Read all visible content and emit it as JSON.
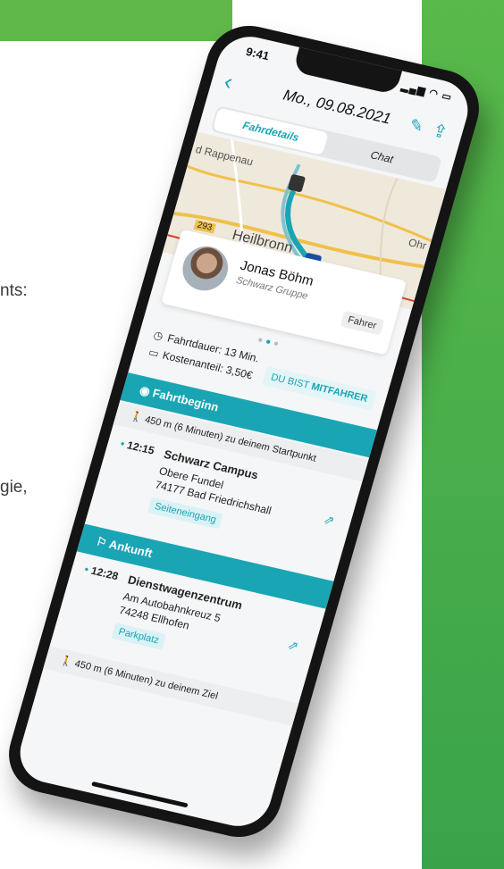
{
  "background": {
    "text_fragment_1": "nts:",
    "text_fragment_2": "gie,"
  },
  "status": {
    "time": "9:41",
    "icons": "▂▄▆ ◠ ▭"
  },
  "header": {
    "back": "‹",
    "title": "Mo., 09.08.2021",
    "edit": "✎",
    "share": "⇪"
  },
  "tabs": {
    "left": "Fahrdetails",
    "right": "Chat"
  },
  "map": {
    "label_top": "d Rappenau",
    "label_road": "293",
    "label_city": "Heilbronn",
    "label_right": "Ohr"
  },
  "driver": {
    "name": "Jonas Böhm",
    "group": "Schwarz Gruppe",
    "role": "Fahrer"
  },
  "pager": {
    "dot1": "●",
    "dot2": "●",
    "dot3": "●"
  },
  "meta": {
    "duration": "Fahrtdauer: 13 Min.",
    "cost": "Kostenanteil: 3,50€",
    "clock_icon": "◷",
    "card_icon": "▭"
  },
  "badge": {
    "prefix": "DU BIST ",
    "strong": "MITFAHRER"
  },
  "start": {
    "header": "Fahrtbeginn",
    "header_icon": "◉",
    "walk": "450 m (6 Minuten) zu deinem Startpunkt",
    "walk_icon": "🚶",
    "time": "12:15",
    "name": "Schwarz Campus",
    "addr1": "Obere Fundel",
    "addr2": "74177 Bad Friedrichshall",
    "tag": "Seiteneingang",
    "nav_icon": "⇗"
  },
  "arrival": {
    "header": "Ankunft",
    "header_icon": "⚐",
    "time": "12:28",
    "name": "Dienstwagenzentrum",
    "addr1": "Am Autobahnkreuz 5",
    "addr2": "74248 Ellhofen",
    "tag": "Parkplatz",
    "nav_icon": "⇗",
    "walk": "450 m (6 Minuten) zu deinem Ziel",
    "walk_icon": "🚶"
  },
  "colors": {
    "accent": "#1aa5b5",
    "brand_green": "#5fb847"
  }
}
